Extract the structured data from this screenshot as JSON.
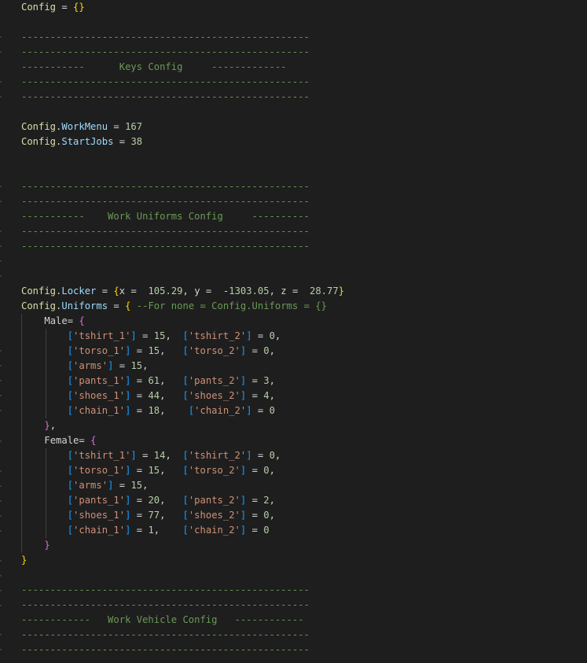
{
  "editor": {
    "theme": "dark",
    "colors": {
      "background": "#1e1e1e",
      "comment": "#6a9955",
      "identifier_global": "#dcdcaa",
      "property": "#9cdcfe",
      "number": "#b5cea8",
      "string": "#ce9178",
      "bracket_level_1": "#ffd700",
      "bracket_level_2": "#da70d6",
      "bracket_level_3": "#179fff"
    }
  },
  "lines": [
    [
      {
        "t": "kw",
        "v": "Config"
      },
      {
        "t": "op",
        "v": " = "
      },
      {
        "t": "br1",
        "v": "{}"
      }
    ],
    [],
    [
      {
        "t": "com",
        "v": "--------------------------------------------------"
      }
    ],
    [
      {
        "t": "com",
        "v": "--------------------------------------------------"
      }
    ],
    [
      {
        "t": "com",
        "v": "-----------      Keys Config     -------------"
      }
    ],
    [
      {
        "t": "com",
        "v": "--------------------------------------------------"
      }
    ],
    [
      {
        "t": "com",
        "v": "--------------------------------------------------"
      }
    ],
    [],
    [
      {
        "t": "kw",
        "v": "Config"
      },
      {
        "t": "op",
        "v": "."
      },
      {
        "t": "prop",
        "v": "WorkMenu"
      },
      {
        "t": "op",
        "v": " = "
      },
      {
        "t": "num",
        "v": "167"
      }
    ],
    [
      {
        "t": "kw",
        "v": "Config"
      },
      {
        "t": "op",
        "v": "."
      },
      {
        "t": "prop",
        "v": "StartJobs"
      },
      {
        "t": "op",
        "v": " = "
      },
      {
        "t": "num",
        "v": "38"
      }
    ],
    [],
    [],
    [
      {
        "t": "com",
        "v": "--------------------------------------------------"
      }
    ],
    [
      {
        "t": "com",
        "v": "--------------------------------------------------"
      }
    ],
    [
      {
        "t": "com",
        "v": "-----------    Work Uniforms Config     ----------"
      }
    ],
    [
      {
        "t": "com",
        "v": "--------------------------------------------------"
      }
    ],
    [
      {
        "t": "com",
        "v": "--------------------------------------------------"
      }
    ],
    [],
    [],
    [
      {
        "t": "kw",
        "v": "Config"
      },
      {
        "t": "op",
        "v": "."
      },
      {
        "t": "prop",
        "v": "Locker"
      },
      {
        "t": "op",
        "v": " = "
      },
      {
        "t": "br1",
        "v": "{"
      },
      {
        "t": "ident",
        "v": "x"
      },
      {
        "t": "op",
        "v": " =  "
      },
      {
        "t": "num",
        "v": "105.29"
      },
      {
        "t": "op",
        "v": ", "
      },
      {
        "t": "ident",
        "v": "y"
      },
      {
        "t": "op",
        "v": " =  "
      },
      {
        "t": "op",
        "v": "-"
      },
      {
        "t": "num",
        "v": "1303.05"
      },
      {
        "t": "op",
        "v": ", "
      },
      {
        "t": "ident",
        "v": "z"
      },
      {
        "t": "op",
        "v": " =  "
      },
      {
        "t": "num",
        "v": "28.77"
      },
      {
        "t": "br1",
        "v": "}"
      }
    ],
    [
      {
        "t": "kw",
        "v": "Config"
      },
      {
        "t": "op",
        "v": "."
      },
      {
        "t": "prop",
        "v": "Uniforms"
      },
      {
        "t": "op",
        "v": " = "
      },
      {
        "t": "br1",
        "v": "{"
      },
      {
        "t": "op",
        "v": " "
      },
      {
        "t": "com",
        "v": "--For none = Config.Uniforms = {}"
      }
    ],
    [
      {
        "t": "op",
        "v": "    "
      },
      {
        "t": "ident",
        "v": "Male"
      },
      {
        "t": "op",
        "v": "= "
      },
      {
        "t": "br2",
        "v": "{"
      }
    ],
    [
      {
        "t": "op",
        "v": "        "
      },
      {
        "t": "br3",
        "v": "["
      },
      {
        "t": "str",
        "v": "'tshirt_1'"
      },
      {
        "t": "br3",
        "v": "]"
      },
      {
        "t": "op",
        "v": " = "
      },
      {
        "t": "num",
        "v": "15"
      },
      {
        "t": "op",
        "v": ",  "
      },
      {
        "t": "br3",
        "v": "["
      },
      {
        "t": "str",
        "v": "'tshirt_2'"
      },
      {
        "t": "br3",
        "v": "]"
      },
      {
        "t": "op",
        "v": " = "
      },
      {
        "t": "num",
        "v": "0"
      },
      {
        "t": "op",
        "v": ","
      }
    ],
    [
      {
        "t": "op",
        "v": "        "
      },
      {
        "t": "br3",
        "v": "["
      },
      {
        "t": "str",
        "v": "'torso_1'"
      },
      {
        "t": "br3",
        "v": "]"
      },
      {
        "t": "op",
        "v": " = "
      },
      {
        "t": "num",
        "v": "15"
      },
      {
        "t": "op",
        "v": ",   "
      },
      {
        "t": "br3",
        "v": "["
      },
      {
        "t": "str",
        "v": "'torso_2'"
      },
      {
        "t": "br3",
        "v": "]"
      },
      {
        "t": "op",
        "v": " = "
      },
      {
        "t": "num",
        "v": "0"
      },
      {
        "t": "op",
        "v": ","
      }
    ],
    [
      {
        "t": "op",
        "v": "        "
      },
      {
        "t": "br3",
        "v": "["
      },
      {
        "t": "str",
        "v": "'arms'"
      },
      {
        "t": "br3",
        "v": "]"
      },
      {
        "t": "op",
        "v": " = "
      },
      {
        "t": "num",
        "v": "15"
      },
      {
        "t": "op",
        "v": ","
      }
    ],
    [
      {
        "t": "op",
        "v": "        "
      },
      {
        "t": "br3",
        "v": "["
      },
      {
        "t": "str",
        "v": "'pants_1'"
      },
      {
        "t": "br3",
        "v": "]"
      },
      {
        "t": "op",
        "v": " = "
      },
      {
        "t": "num",
        "v": "61"
      },
      {
        "t": "op",
        "v": ",   "
      },
      {
        "t": "br3",
        "v": "["
      },
      {
        "t": "str",
        "v": "'pants_2'"
      },
      {
        "t": "br3",
        "v": "]"
      },
      {
        "t": "op",
        "v": " = "
      },
      {
        "t": "num",
        "v": "3"
      },
      {
        "t": "op",
        "v": ","
      }
    ],
    [
      {
        "t": "op",
        "v": "        "
      },
      {
        "t": "br3",
        "v": "["
      },
      {
        "t": "str",
        "v": "'shoes_1'"
      },
      {
        "t": "br3",
        "v": "]"
      },
      {
        "t": "op",
        "v": " = "
      },
      {
        "t": "num",
        "v": "44"
      },
      {
        "t": "op",
        "v": ",   "
      },
      {
        "t": "br3",
        "v": "["
      },
      {
        "t": "str",
        "v": "'shoes_2'"
      },
      {
        "t": "br3",
        "v": "]"
      },
      {
        "t": "op",
        "v": " = "
      },
      {
        "t": "num",
        "v": "4"
      },
      {
        "t": "op",
        "v": ","
      }
    ],
    [
      {
        "t": "op",
        "v": "        "
      },
      {
        "t": "br3",
        "v": "["
      },
      {
        "t": "str",
        "v": "'chain_1'"
      },
      {
        "t": "br3",
        "v": "]"
      },
      {
        "t": "op",
        "v": " = "
      },
      {
        "t": "num",
        "v": "18"
      },
      {
        "t": "op",
        "v": ",    "
      },
      {
        "t": "br3",
        "v": "["
      },
      {
        "t": "str",
        "v": "'chain_2'"
      },
      {
        "t": "br3",
        "v": "]"
      },
      {
        "t": "op",
        "v": " = "
      },
      {
        "t": "num",
        "v": "0"
      }
    ],
    [
      {
        "t": "op",
        "v": "    "
      },
      {
        "t": "br2",
        "v": "}"
      },
      {
        "t": "op",
        "v": ","
      }
    ],
    [
      {
        "t": "op",
        "v": "    "
      },
      {
        "t": "ident",
        "v": "Female"
      },
      {
        "t": "op",
        "v": "= "
      },
      {
        "t": "br2",
        "v": "{"
      }
    ],
    [
      {
        "t": "op",
        "v": "        "
      },
      {
        "t": "br3",
        "v": "["
      },
      {
        "t": "str",
        "v": "'tshirt_1'"
      },
      {
        "t": "br3",
        "v": "]"
      },
      {
        "t": "op",
        "v": " = "
      },
      {
        "t": "num",
        "v": "14"
      },
      {
        "t": "op",
        "v": ",  "
      },
      {
        "t": "br3",
        "v": "["
      },
      {
        "t": "str",
        "v": "'tshirt_2'"
      },
      {
        "t": "br3",
        "v": "]"
      },
      {
        "t": "op",
        "v": " = "
      },
      {
        "t": "num",
        "v": "0"
      },
      {
        "t": "op",
        "v": ","
      }
    ],
    [
      {
        "t": "op",
        "v": "        "
      },
      {
        "t": "br3",
        "v": "["
      },
      {
        "t": "str",
        "v": "'torso_1'"
      },
      {
        "t": "br3",
        "v": "]"
      },
      {
        "t": "op",
        "v": " = "
      },
      {
        "t": "num",
        "v": "15"
      },
      {
        "t": "op",
        "v": ",   "
      },
      {
        "t": "br3",
        "v": "["
      },
      {
        "t": "str",
        "v": "'torso_2'"
      },
      {
        "t": "br3",
        "v": "]"
      },
      {
        "t": "op",
        "v": " = "
      },
      {
        "t": "num",
        "v": "0"
      },
      {
        "t": "op",
        "v": ","
      }
    ],
    [
      {
        "t": "op",
        "v": "        "
      },
      {
        "t": "br3",
        "v": "["
      },
      {
        "t": "str",
        "v": "'arms'"
      },
      {
        "t": "br3",
        "v": "]"
      },
      {
        "t": "op",
        "v": " = "
      },
      {
        "t": "num",
        "v": "15"
      },
      {
        "t": "op",
        "v": ","
      }
    ],
    [
      {
        "t": "op",
        "v": "        "
      },
      {
        "t": "br3",
        "v": "["
      },
      {
        "t": "str",
        "v": "'pants_1'"
      },
      {
        "t": "br3",
        "v": "]"
      },
      {
        "t": "op",
        "v": " = "
      },
      {
        "t": "num",
        "v": "20"
      },
      {
        "t": "op",
        "v": ",   "
      },
      {
        "t": "br3",
        "v": "["
      },
      {
        "t": "str",
        "v": "'pants_2'"
      },
      {
        "t": "br3",
        "v": "]"
      },
      {
        "t": "op",
        "v": " = "
      },
      {
        "t": "num",
        "v": "2"
      },
      {
        "t": "op",
        "v": ","
      }
    ],
    [
      {
        "t": "op",
        "v": "        "
      },
      {
        "t": "br3",
        "v": "["
      },
      {
        "t": "str",
        "v": "'shoes_1'"
      },
      {
        "t": "br3",
        "v": "]"
      },
      {
        "t": "op",
        "v": " = "
      },
      {
        "t": "num",
        "v": "77"
      },
      {
        "t": "op",
        "v": ",   "
      },
      {
        "t": "br3",
        "v": "["
      },
      {
        "t": "str",
        "v": "'shoes_2'"
      },
      {
        "t": "br3",
        "v": "]"
      },
      {
        "t": "op",
        "v": " = "
      },
      {
        "t": "num",
        "v": "0"
      },
      {
        "t": "op",
        "v": ","
      }
    ],
    [
      {
        "t": "op",
        "v": "        "
      },
      {
        "t": "br3",
        "v": "["
      },
      {
        "t": "str",
        "v": "'chain_1'"
      },
      {
        "t": "br3",
        "v": "]"
      },
      {
        "t": "op",
        "v": " = "
      },
      {
        "t": "num",
        "v": "1"
      },
      {
        "t": "op",
        "v": ",    "
      },
      {
        "t": "br3",
        "v": "["
      },
      {
        "t": "str",
        "v": "'chain_2'"
      },
      {
        "t": "br3",
        "v": "]"
      },
      {
        "t": "op",
        "v": " = "
      },
      {
        "t": "num",
        "v": "0"
      }
    ],
    [
      {
        "t": "op",
        "v": "    "
      },
      {
        "t": "br2",
        "v": "}"
      }
    ],
    [
      {
        "t": "br1",
        "v": "}"
      }
    ],
    [],
    [
      {
        "t": "com",
        "v": "--------------------------------------------------"
      }
    ],
    [
      {
        "t": "com",
        "v": "--------------------------------------------------"
      }
    ],
    [
      {
        "t": "com",
        "v": "------------   Work Vehicle Config   ------------"
      }
    ],
    [
      {
        "t": "com",
        "v": "--------------------------------------------------"
      }
    ],
    [
      {
        "t": "com",
        "v": "--------------------------------------------------"
      }
    ]
  ]
}
